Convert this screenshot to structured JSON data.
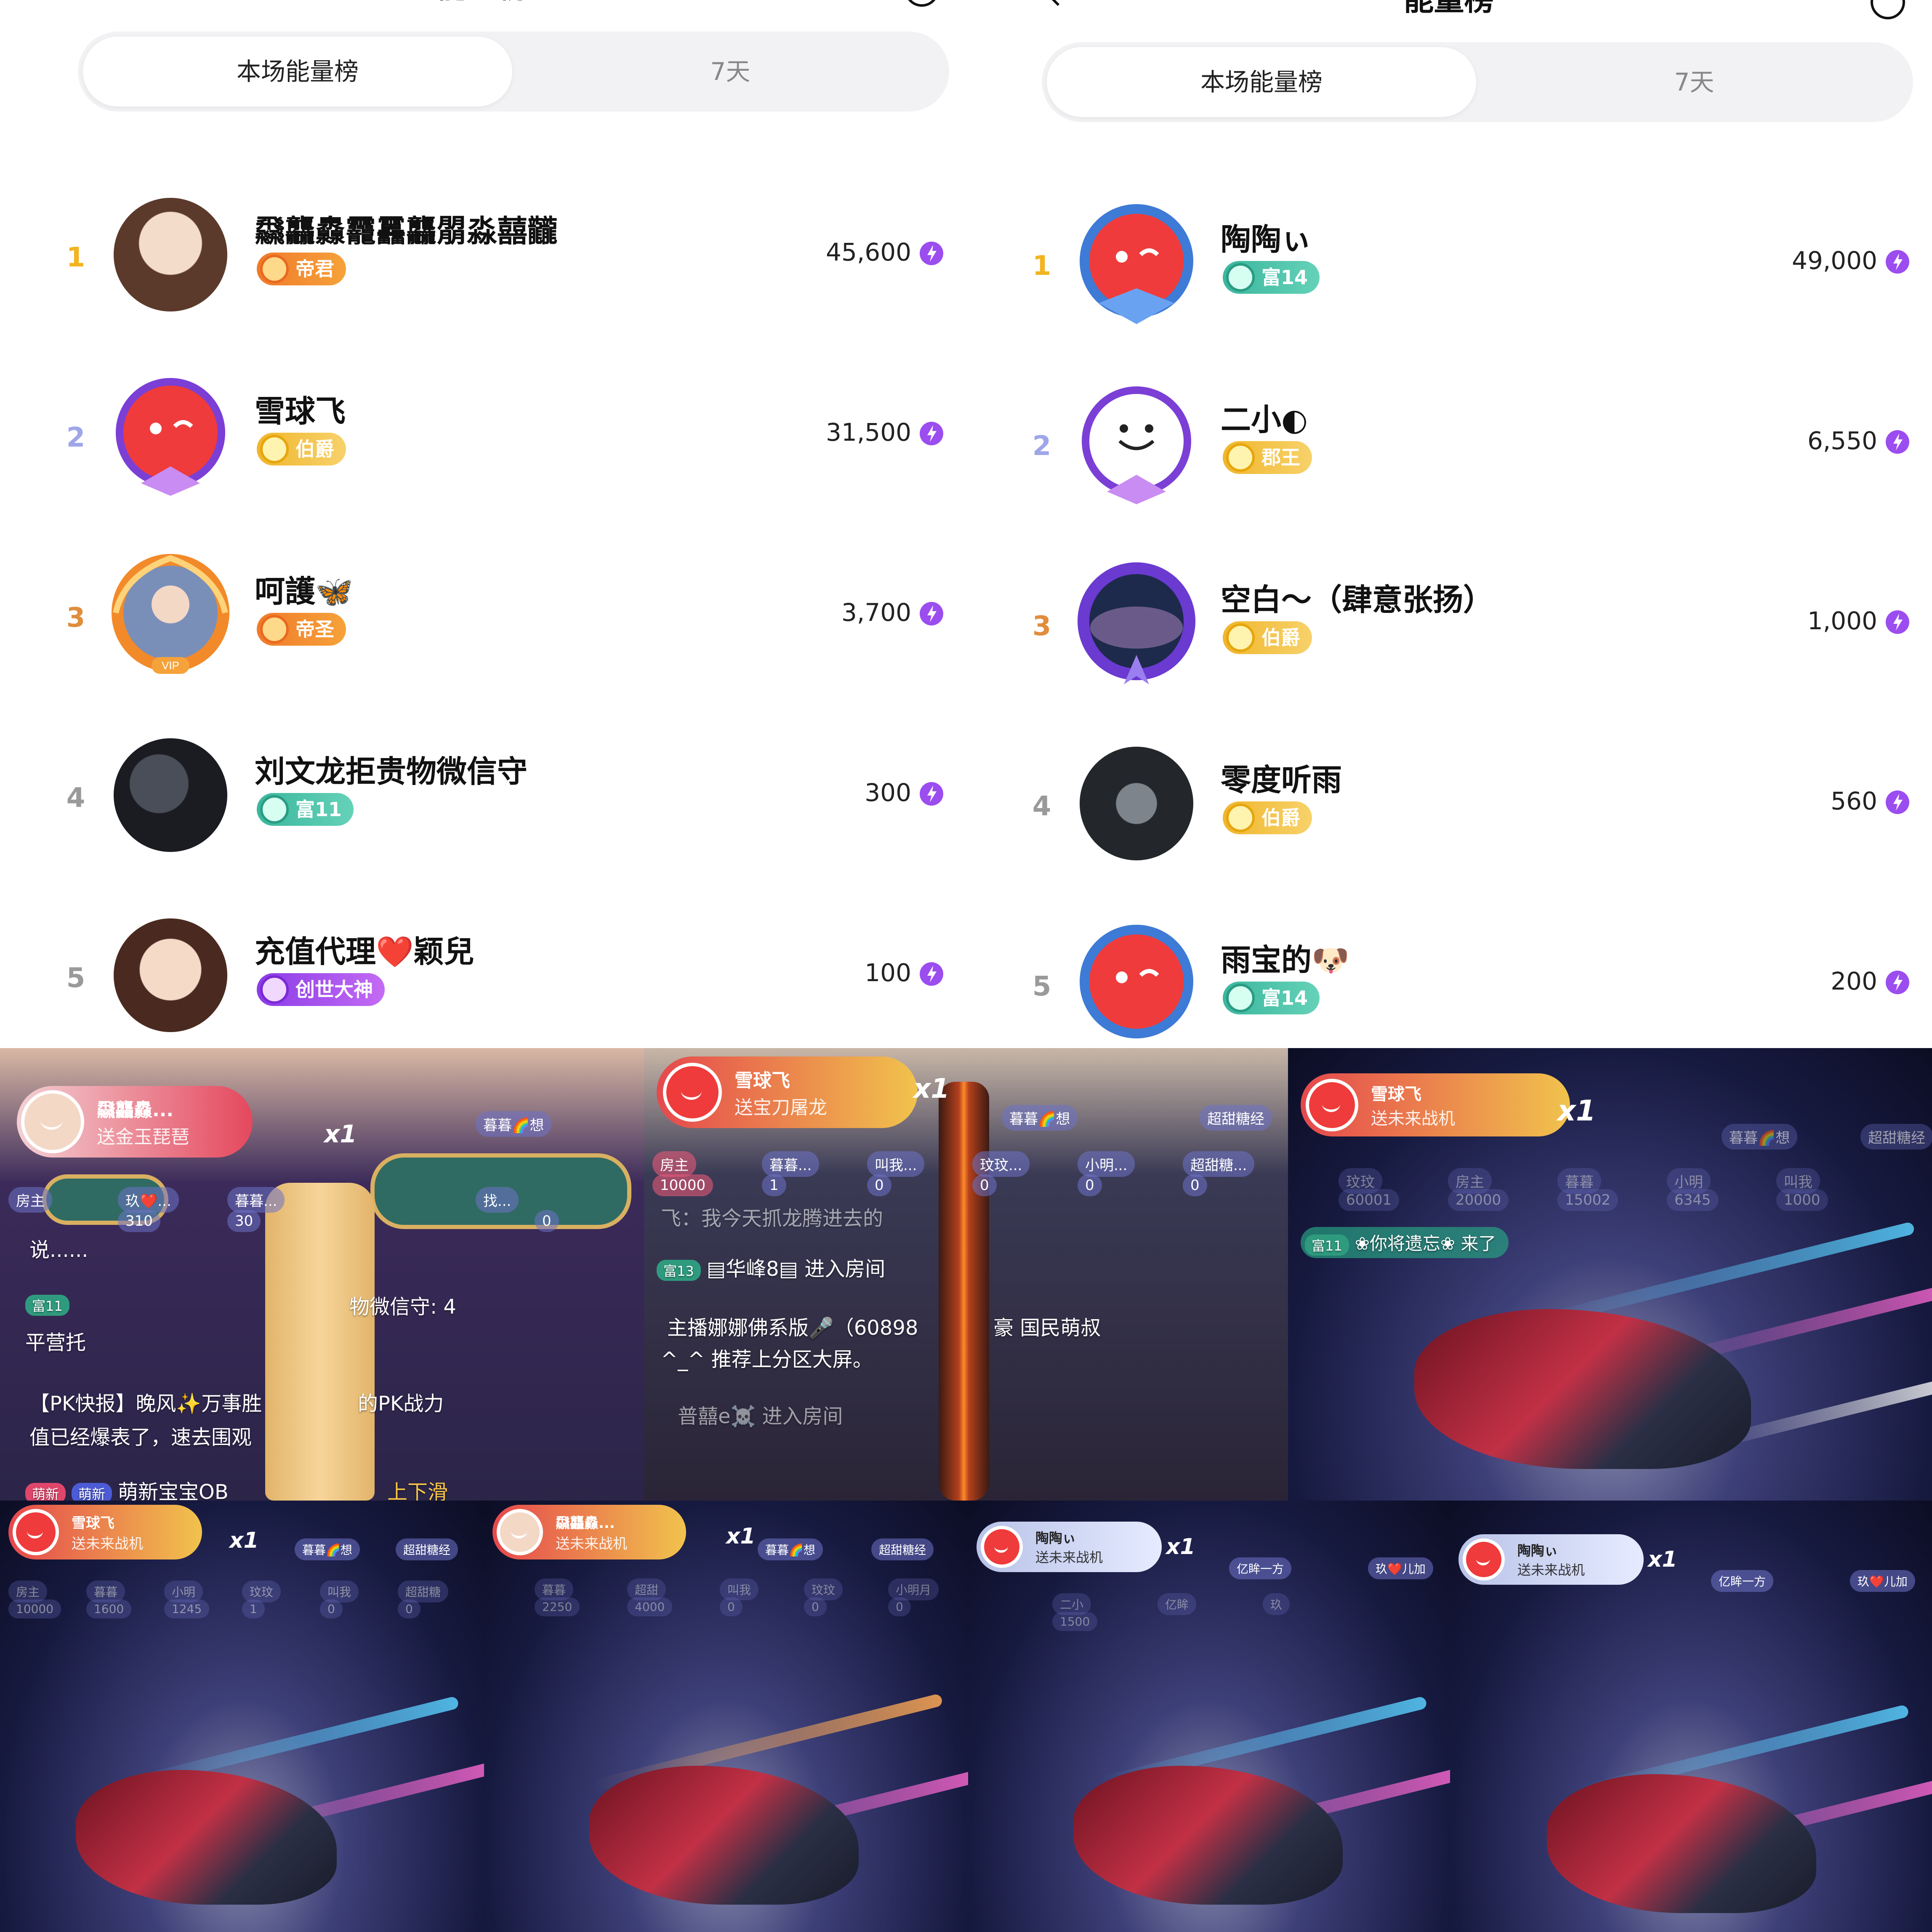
{
  "panels": {
    "left": {
      "title": "能量榜",
      "tabs": [
        "本场能量榜",
        "7天"
      ],
      "rows": [
        {
          "rank": "1",
          "name": "飝龘灥龗靐龘朤淼囍龖",
          "badge": "帝君",
          "score": "45,600"
        },
        {
          "rank": "2",
          "name": "雪球飞",
          "badge": "伯爵",
          "score": "31,500"
        },
        {
          "rank": "3",
          "name": "呵護🦋",
          "badge": "帝圣",
          "score": "3,700"
        },
        {
          "rank": "4",
          "name": "刘文龙拒贵物微信守",
          "badge": "富11",
          "score": "300"
        },
        {
          "rank": "5",
          "name": "充值代理❤️颖兒",
          "badge": "创世大神",
          "score": "100"
        }
      ]
    },
    "right": {
      "title": "能量榜",
      "tabs": [
        "本场能量榜",
        "7天"
      ],
      "rows": [
        {
          "rank": "1",
          "name": "陶陶ぃ",
          "badge": "富14",
          "score": "49,000"
        },
        {
          "rank": "2",
          "name": "二小◐",
          "badge": "郡王",
          "score": "6,550"
        },
        {
          "rank": "3",
          "name": "空白～（肆意张扬）",
          "badge": "伯爵",
          "score": "1,000"
        },
        {
          "rank": "4",
          "name": "零度听雨",
          "badge": "伯爵",
          "score": "560"
        },
        {
          "rank": "5",
          "name": "雨宝的🐶",
          "badge": "富14",
          "score": "200"
        }
      ]
    }
  },
  "clips": {
    "guzheng": {
      "gift_name": "飝龘灥...",
      "gift_sub": "送金玉琵琶",
      "count": "x1",
      "chips": [
        "房主",
        "玖❤️...",
        "暮暮...",
        "找..."
      ],
      "chip_vals": [
        "310",
        "30",
        "0"
      ],
      "chat1": "说......",
      "chat2": "富11",
      "chat3": "物微信守: 4",
      "chat4": "平营托",
      "chat5": "【PK快报】晚风✨万事胜",
      "chat5b": "的PK战力",
      "chat6": "值已经爆表了，速去围观",
      "chat7_tag1": "萌新",
      "chat7_tag2": "萌新",
      "chat7": "萌新宝宝OB",
      "chat7b": "上下滑",
      "chat_top": "暮暮🌈想"
    },
    "sword": {
      "gift_name": "雪球飞",
      "gift_sub": "送宝刀屠龙",
      "count": "x1",
      "chips": [
        "房主",
        "暮暮...",
        "叫我...",
        "玟玟...",
        "小明...",
        "超甜糖..."
      ],
      "chip_vals": [
        "10000",
        "1",
        "0",
        "0",
        "0",
        "0"
      ],
      "top_chip1": "暮暮🌈想",
      "top_chip2": "超甜糖经",
      "chat1": "飞：我今天抓龙腾进去的",
      "chat2_tag": "富13",
      "chat2": "▤华峰8▤  进入房间",
      "chat3": "主播娜娜佛系版🎤（60898",
      "chat3b": "豪 国民萌叔",
      "chat4": "^_^ 推荐上分区大屏。",
      "chat5": "普囍e☠️  进入房间"
    },
    "space1": {
      "gift_name": "雪球飞",
      "gift_sub": "送未来战机",
      "count": "x1",
      "chip_top1": "暮暮🌈想",
      "chip_top2": "超甜糖经",
      "chips": [
        "玟玟",
        "房主",
        "暮暮",
        "小明",
        "叫我"
      ],
      "chip_vals": [
        "60001",
        "20000",
        "15002",
        "6345",
        "1000"
      ],
      "chat_tag": "富11",
      "chat": "❀你将遗忘❀ 来了"
    },
    "space2": {
      "gift_name": "雪球飞",
      "gift_sub": "送未来战机",
      "count": "x1",
      "top1": "暮暮🌈想",
      "top2": "超甜糖经",
      "chips": [
        "房主",
        "暮暮",
        "小明",
        "玟玟",
        "叫我",
        "超甜糖"
      ],
      "chip_vals": [
        "10000",
        "1600",
        "1245",
        "1",
        "0",
        "0"
      ]
    },
    "space3": {
      "gift_name": "飝龘灥...",
      "gift_sub": "送未来战机",
      "count": "x1",
      "top1": "暮暮🌈想",
      "top2": "超甜糖经",
      "chips": [
        "暮暮",
        "超甜",
        "叫我",
        "玟玟",
        "小明月"
      ],
      "chip_vals": [
        "2250",
        "4000",
        "0",
        "0",
        "0"
      ]
    },
    "space4": {
      "gift_name": "陶陶ぃ",
      "gift_sub": "送未来战机",
      "count": "x1",
      "top1": "亿眸一方",
      "top2": "玖❤️儿加",
      "chips": [
        "二小",
        "亿眸",
        "玖"
      ],
      "chip_vals": [
        "1500",
        "",
        ""
      ]
    },
    "space5": {
      "gift_name": "陶陶ぃ",
      "gift_sub": "送未来战机",
      "count": "x1",
      "top1": "亿眸一方",
      "top2": "玖❤️儿加"
    }
  },
  "colors": {
    "gold": "#f2b420",
    "silver": "#9fa6e8",
    "bronze": "#e08d3c",
    "energy": "#9b4df0",
    "gift_pill": "#e5484d"
  },
  "icons": [
    "back-icon",
    "info-icon",
    "energy-icon",
    "badge-icon",
    "avatar-frame"
  ]
}
